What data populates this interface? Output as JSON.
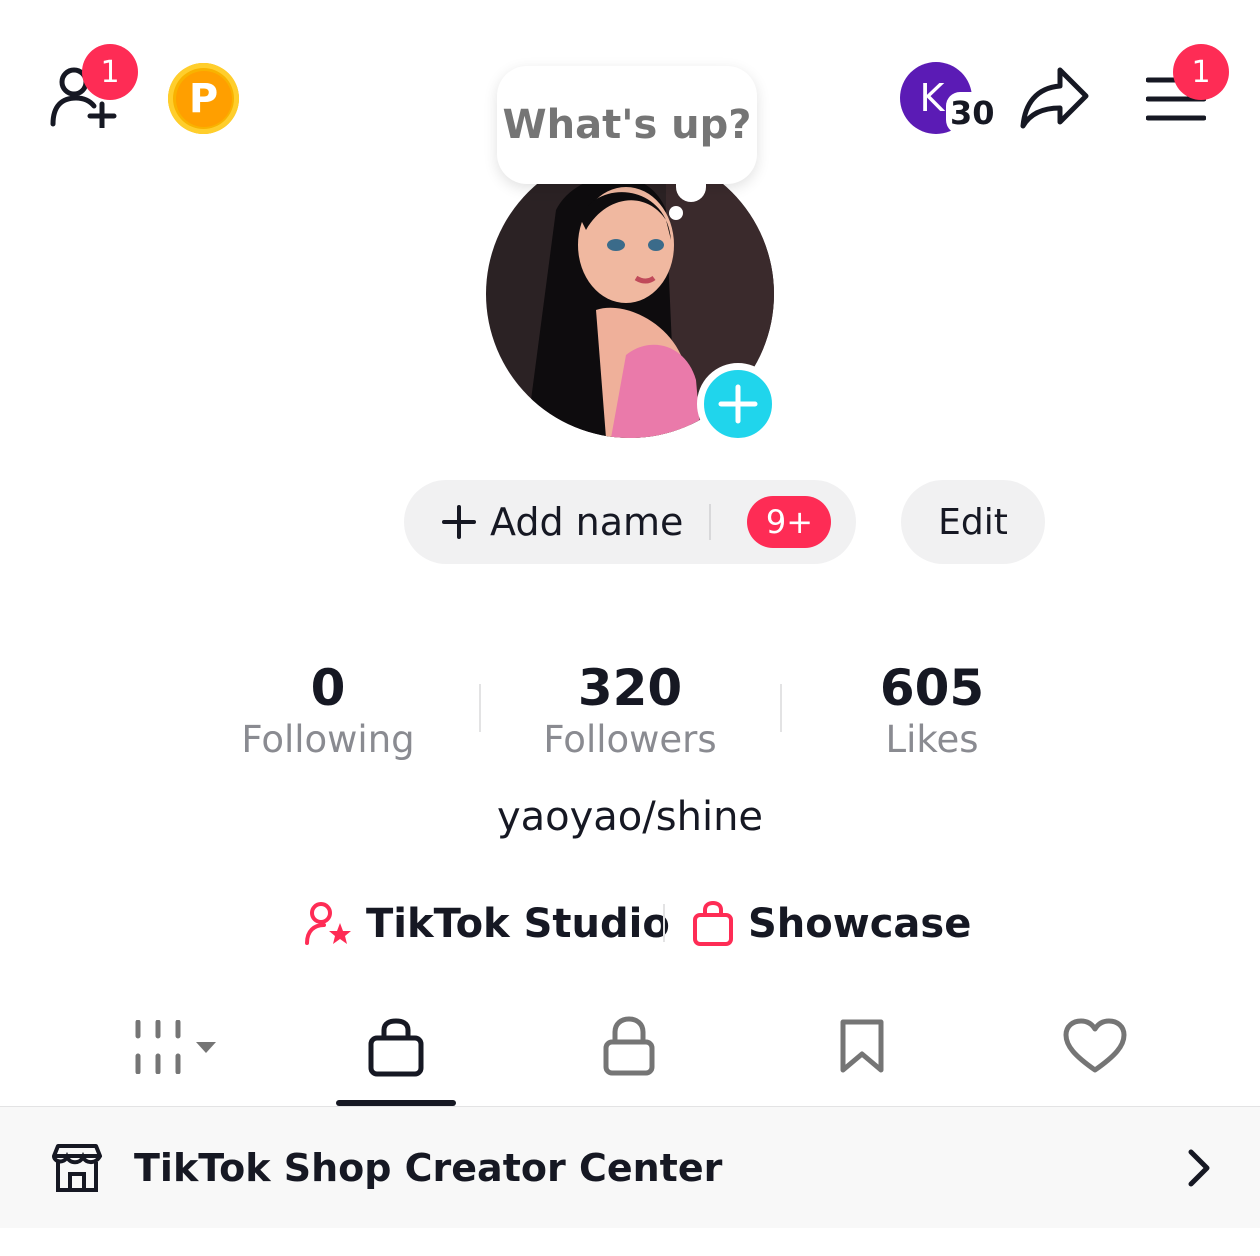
{
  "colors": {
    "accent": "#fe2c55",
    "cyan": "#20d5ec",
    "text": "#161823",
    "muted": "#8a8b91",
    "purple": "#5b1bb5",
    "coin": "#f9b200"
  },
  "header": {
    "add_friends_badge": "1",
    "coin_letter": "P",
    "avatar_letter": "K",
    "avatar_count": "30",
    "menu_badge": "1"
  },
  "profile": {
    "status_prompt": "What's up?",
    "add_name_label": "Add name",
    "notification_badge": "9+",
    "edit_label": "Edit",
    "username": "yaoyao/shine"
  },
  "stats": [
    {
      "value": "0",
      "label": "Following"
    },
    {
      "value": "320",
      "label": "Followers"
    },
    {
      "value": "605",
      "label": "Likes"
    }
  ],
  "links": {
    "studio_label": "TikTok Studio",
    "showcase_label": "Showcase"
  },
  "tabs": [
    "videos",
    "shop",
    "private",
    "favorites",
    "liked"
  ],
  "active_tab": "shop",
  "shop_bar": {
    "label": "TikTok Shop Creator Center"
  }
}
